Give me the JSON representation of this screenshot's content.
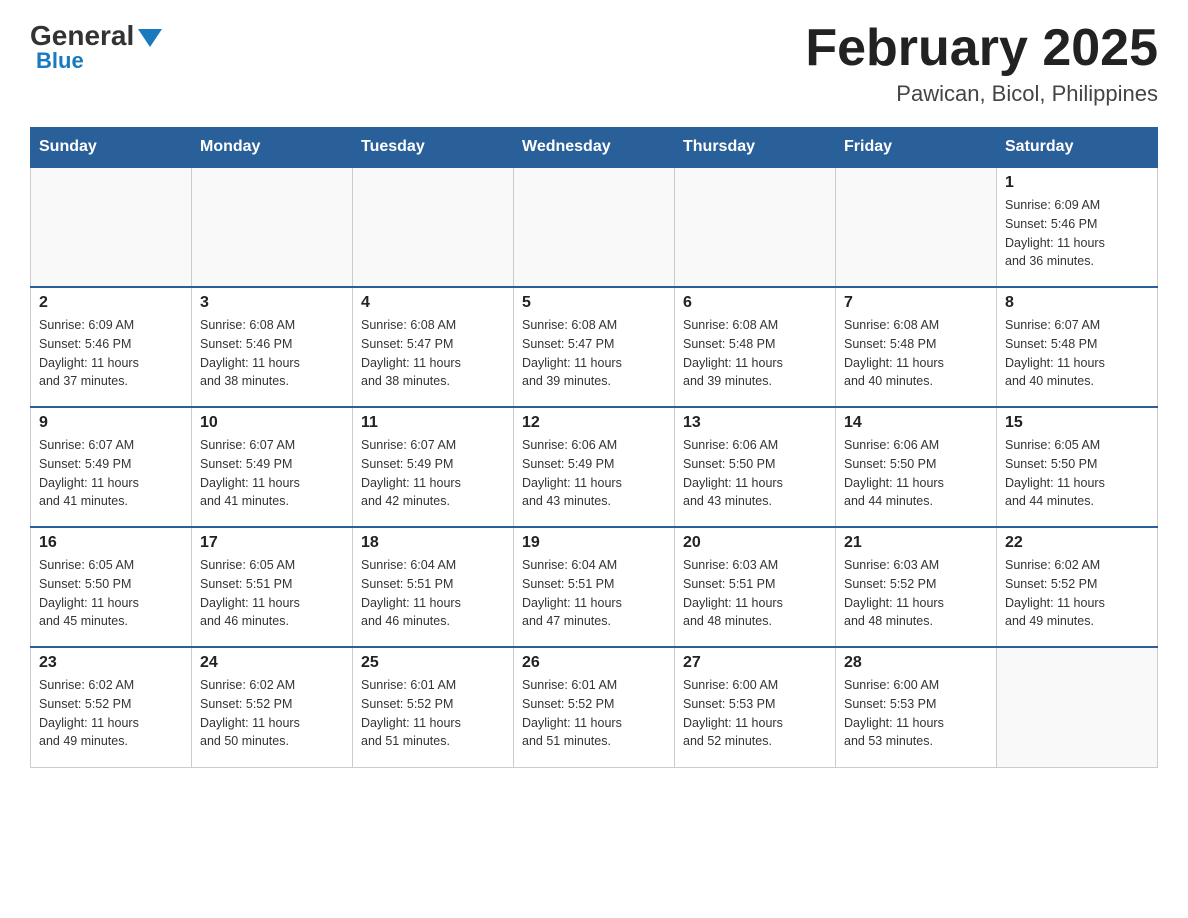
{
  "header": {
    "logo": {
      "general": "General",
      "blue": "Blue"
    },
    "title": "February 2025",
    "location": "Pawican, Bicol, Philippines"
  },
  "days_of_week": [
    "Sunday",
    "Monday",
    "Tuesday",
    "Wednesday",
    "Thursday",
    "Friday",
    "Saturday"
  ],
  "weeks": [
    {
      "days": [
        {
          "num": "",
          "info": ""
        },
        {
          "num": "",
          "info": ""
        },
        {
          "num": "",
          "info": ""
        },
        {
          "num": "",
          "info": ""
        },
        {
          "num": "",
          "info": ""
        },
        {
          "num": "",
          "info": ""
        },
        {
          "num": "1",
          "info": "Sunrise: 6:09 AM\nSunset: 5:46 PM\nDaylight: 11 hours\nand 36 minutes."
        }
      ]
    },
    {
      "days": [
        {
          "num": "2",
          "info": "Sunrise: 6:09 AM\nSunset: 5:46 PM\nDaylight: 11 hours\nand 37 minutes."
        },
        {
          "num": "3",
          "info": "Sunrise: 6:08 AM\nSunset: 5:46 PM\nDaylight: 11 hours\nand 38 minutes."
        },
        {
          "num": "4",
          "info": "Sunrise: 6:08 AM\nSunset: 5:47 PM\nDaylight: 11 hours\nand 38 minutes."
        },
        {
          "num": "5",
          "info": "Sunrise: 6:08 AM\nSunset: 5:47 PM\nDaylight: 11 hours\nand 39 minutes."
        },
        {
          "num": "6",
          "info": "Sunrise: 6:08 AM\nSunset: 5:48 PM\nDaylight: 11 hours\nand 39 minutes."
        },
        {
          "num": "7",
          "info": "Sunrise: 6:08 AM\nSunset: 5:48 PM\nDaylight: 11 hours\nand 40 minutes."
        },
        {
          "num": "8",
          "info": "Sunrise: 6:07 AM\nSunset: 5:48 PM\nDaylight: 11 hours\nand 40 minutes."
        }
      ]
    },
    {
      "days": [
        {
          "num": "9",
          "info": "Sunrise: 6:07 AM\nSunset: 5:49 PM\nDaylight: 11 hours\nand 41 minutes."
        },
        {
          "num": "10",
          "info": "Sunrise: 6:07 AM\nSunset: 5:49 PM\nDaylight: 11 hours\nand 41 minutes."
        },
        {
          "num": "11",
          "info": "Sunrise: 6:07 AM\nSunset: 5:49 PM\nDaylight: 11 hours\nand 42 minutes."
        },
        {
          "num": "12",
          "info": "Sunrise: 6:06 AM\nSunset: 5:49 PM\nDaylight: 11 hours\nand 43 minutes."
        },
        {
          "num": "13",
          "info": "Sunrise: 6:06 AM\nSunset: 5:50 PM\nDaylight: 11 hours\nand 43 minutes."
        },
        {
          "num": "14",
          "info": "Sunrise: 6:06 AM\nSunset: 5:50 PM\nDaylight: 11 hours\nand 44 minutes."
        },
        {
          "num": "15",
          "info": "Sunrise: 6:05 AM\nSunset: 5:50 PM\nDaylight: 11 hours\nand 44 minutes."
        }
      ]
    },
    {
      "days": [
        {
          "num": "16",
          "info": "Sunrise: 6:05 AM\nSunset: 5:50 PM\nDaylight: 11 hours\nand 45 minutes."
        },
        {
          "num": "17",
          "info": "Sunrise: 6:05 AM\nSunset: 5:51 PM\nDaylight: 11 hours\nand 46 minutes."
        },
        {
          "num": "18",
          "info": "Sunrise: 6:04 AM\nSunset: 5:51 PM\nDaylight: 11 hours\nand 46 minutes."
        },
        {
          "num": "19",
          "info": "Sunrise: 6:04 AM\nSunset: 5:51 PM\nDaylight: 11 hours\nand 47 minutes."
        },
        {
          "num": "20",
          "info": "Sunrise: 6:03 AM\nSunset: 5:51 PM\nDaylight: 11 hours\nand 48 minutes."
        },
        {
          "num": "21",
          "info": "Sunrise: 6:03 AM\nSunset: 5:52 PM\nDaylight: 11 hours\nand 48 minutes."
        },
        {
          "num": "22",
          "info": "Sunrise: 6:02 AM\nSunset: 5:52 PM\nDaylight: 11 hours\nand 49 minutes."
        }
      ]
    },
    {
      "days": [
        {
          "num": "23",
          "info": "Sunrise: 6:02 AM\nSunset: 5:52 PM\nDaylight: 11 hours\nand 49 minutes."
        },
        {
          "num": "24",
          "info": "Sunrise: 6:02 AM\nSunset: 5:52 PM\nDaylight: 11 hours\nand 50 minutes."
        },
        {
          "num": "25",
          "info": "Sunrise: 6:01 AM\nSunset: 5:52 PM\nDaylight: 11 hours\nand 51 minutes."
        },
        {
          "num": "26",
          "info": "Sunrise: 6:01 AM\nSunset: 5:52 PM\nDaylight: 11 hours\nand 51 minutes."
        },
        {
          "num": "27",
          "info": "Sunrise: 6:00 AM\nSunset: 5:53 PM\nDaylight: 11 hours\nand 52 minutes."
        },
        {
          "num": "28",
          "info": "Sunrise: 6:00 AM\nSunset: 5:53 PM\nDaylight: 11 hours\nand 53 minutes."
        },
        {
          "num": "",
          "info": ""
        }
      ]
    }
  ]
}
